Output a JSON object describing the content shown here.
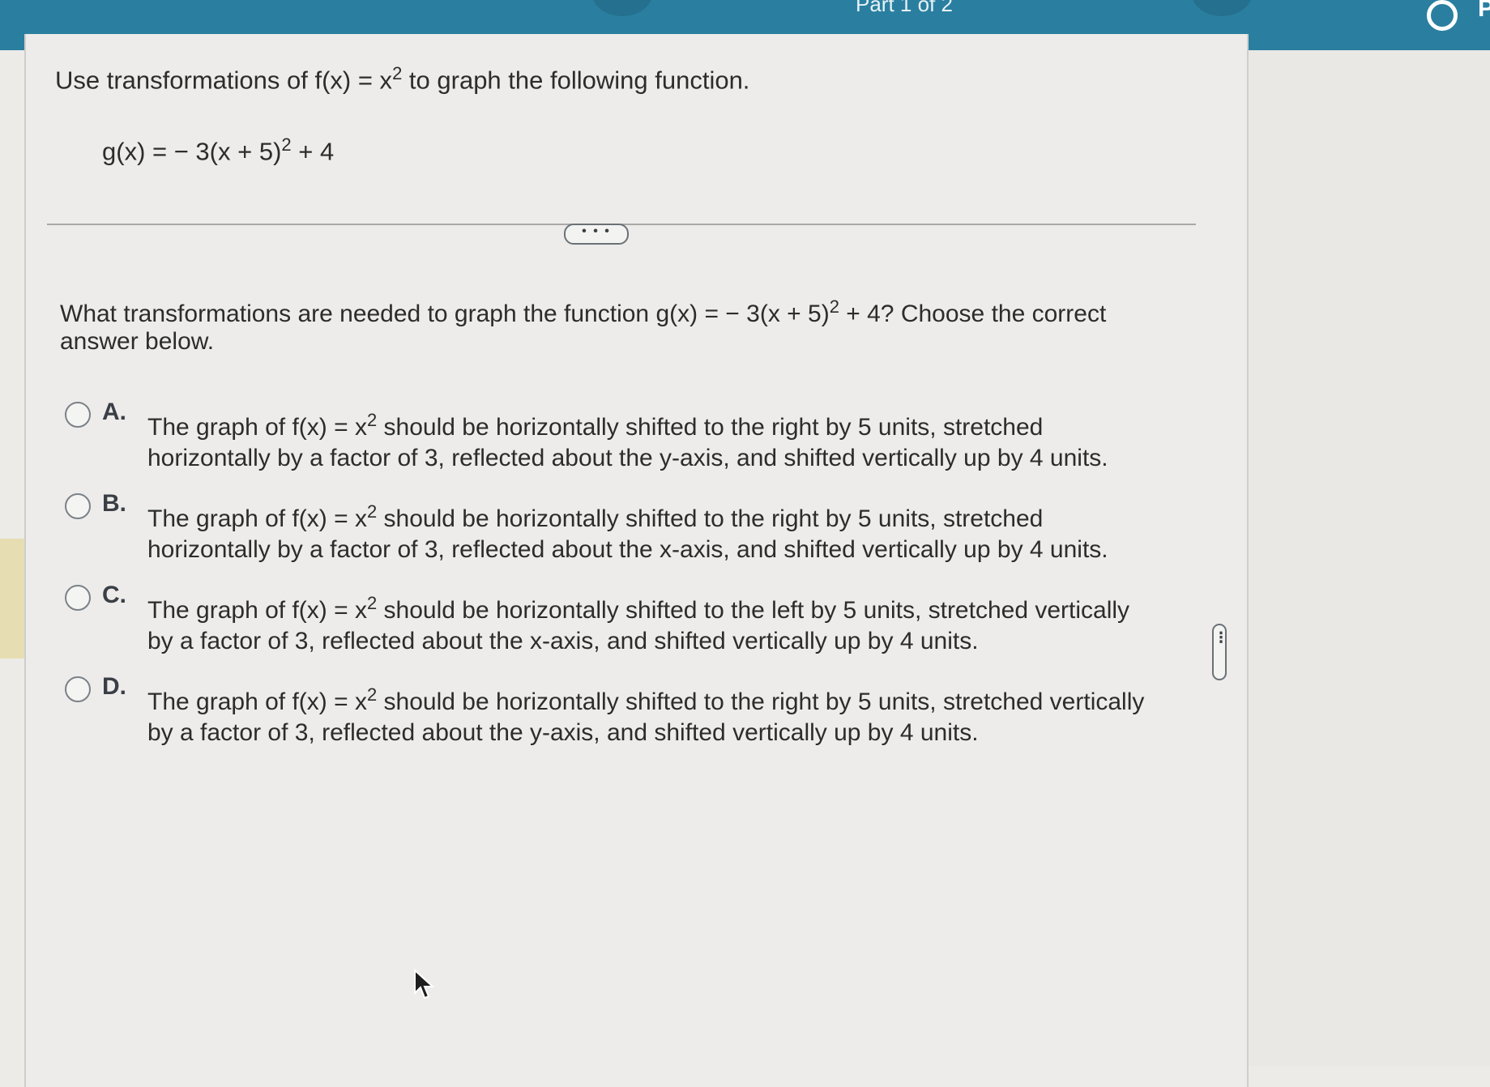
{
  "header": {
    "part_label": "Part 1 of 2",
    "edge_letter": "P"
  },
  "problem": {
    "intro_pre": "Use transformations of f(x) = x",
    "intro_exp": "2",
    "intro_post": " to graph the following function.",
    "function_pre": "g(x) = − 3(x + 5)",
    "function_exp": "2",
    "function_post": " + 4"
  },
  "divider": {
    "button_label": "• • •"
  },
  "question": {
    "text_pre": "What transformations are needed to graph the function g(x) = − 3(x + 5)",
    "text_exp": "2",
    "text_post": " + 4? Choose the correct answer below."
  },
  "options": [
    {
      "letter": "A.",
      "pre": "The graph of f(x) = x",
      "exp": "2",
      "post": " should be horizontally shifted to the right by 5 units, stretched horizontally by a factor of 3, reflected about the y-axis, and shifted vertically up by 4 units."
    },
    {
      "letter": "B.",
      "pre": "The graph of f(x) = x",
      "exp": "2",
      "post": " should be horizontally shifted to the right by 5 units, stretched horizontally by a factor of 3, reflected about the x-axis, and shifted vertically up by 4 units."
    },
    {
      "letter": "C.",
      "pre": "The graph of f(x) = x",
      "exp": "2",
      "post": " should be horizontally shifted to the left by 5 units, stretched vertically by a factor of 3, reflected about the x-axis, and shifted vertically up by 4 units."
    },
    {
      "letter": "D.",
      "pre": "The graph of f(x) = x",
      "exp": "2",
      "post": " should be horizontally shifted to the right by 5 units, stretched vertically by a factor of 3, reflected about the y-axis, and shifted vertically up by 4 units."
    }
  ],
  "side_handle": {
    "label": "⋮"
  },
  "colors": {
    "topbar": "#2a7fa0",
    "panel": "#edecea",
    "left_tab": "#e7ddb2"
  }
}
